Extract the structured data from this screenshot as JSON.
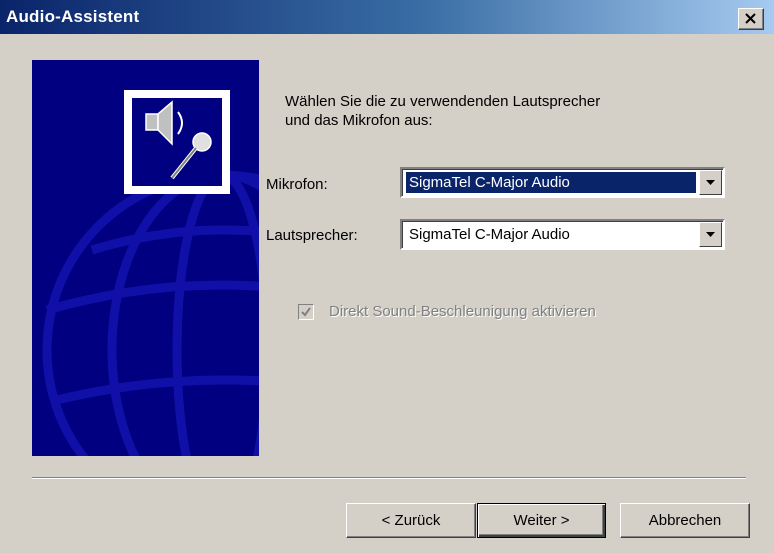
{
  "window": {
    "title": "Audio-Assistent",
    "close_label": "×"
  },
  "intro": {
    "line1": "Wählen Sie die zu verwendenden Lautsprecher",
    "line2": "und das Mikrofon aus:"
  },
  "microphone": {
    "label": "Mikrofon:",
    "value": "SigmaTel C-Major Audio"
  },
  "speakers": {
    "label": "Lautsprecher:",
    "value": "SigmaTel C-Major Audio"
  },
  "checkbox": {
    "label": "Direkt Sound-Beschleunigung aktivieren",
    "checked": true,
    "disabled": true
  },
  "buttons": {
    "back": "< Zurück",
    "next": "Weiter >",
    "cancel": "Abbrechen"
  },
  "colors": {
    "titlebar_start": "#0a246a",
    "titlebar_end": "#a6caf0",
    "panel": "#000080",
    "dialog_bg": "#d4d0c8"
  },
  "icons": {
    "panel_icon": "speaker-microphone-icon",
    "close": "close-icon",
    "dropdown": "chevron-down-icon",
    "check": "checkmark-icon"
  }
}
